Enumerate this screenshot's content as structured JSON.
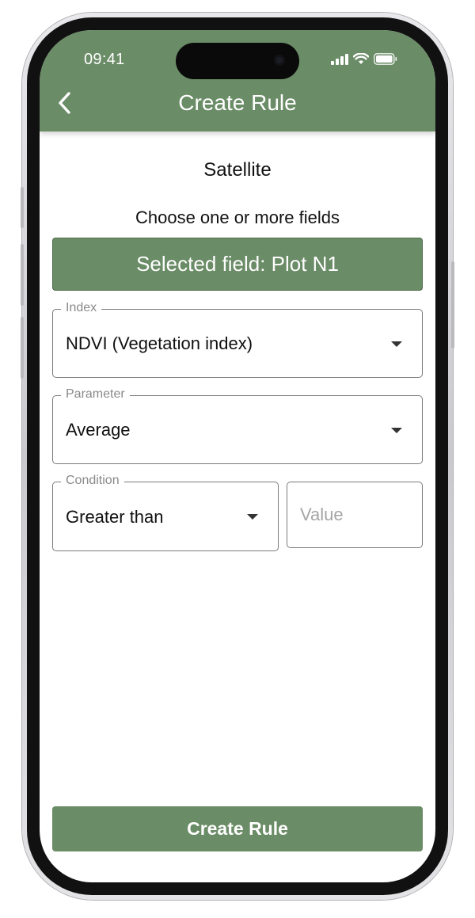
{
  "status_bar": {
    "time": "09:41"
  },
  "header": {
    "title": "Create Rule"
  },
  "form": {
    "section_title": "Satellite",
    "fields_prompt": "Choose one or more fields",
    "selected_field_label": "Selected field: Plot N1",
    "index": {
      "legend": "Index",
      "value": "NDVI (Vegetation index)"
    },
    "parameter": {
      "legend": "Parameter",
      "value": "Average"
    },
    "condition": {
      "legend": "Condition",
      "value": "Greater than"
    },
    "value_input": {
      "placeholder": "Value",
      "value": ""
    }
  },
  "actions": {
    "create_label": "Create Rule"
  },
  "colors": {
    "brand": "#6a8c66",
    "border": "#7a7a7a",
    "placeholder": "#a5a5a5"
  }
}
